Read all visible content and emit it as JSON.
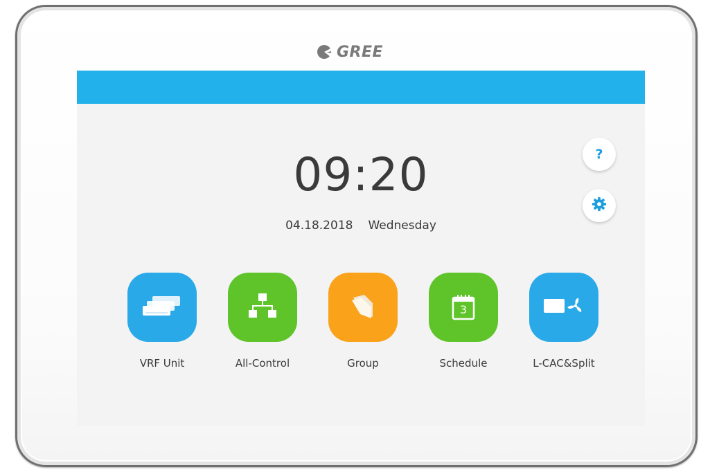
{
  "brand": {
    "name": "GREE",
    "logo_icon": "gree-logo-icon"
  },
  "colors": {
    "header_bar": "#22b1ea",
    "tile_blue": "#2aa9e8",
    "tile_green": "#5fc42a",
    "tile_orange": "#f9a21a",
    "accent_icon": "#1e9ee0"
  },
  "clock": {
    "time": "09:20",
    "date": "04.18.2018",
    "weekday": "Wednesday"
  },
  "side_buttons": [
    {
      "name": "help",
      "glyph": "?",
      "icon": "question-icon"
    },
    {
      "name": "settings",
      "icon": "gear-icon"
    }
  ],
  "tiles": [
    {
      "label": "VRF Unit",
      "icon": "indoor-units-icon",
      "color": "blue"
    },
    {
      "label": "All-Control",
      "icon": "network-hierarchy-icon",
      "color": "green"
    },
    {
      "label": "Group",
      "icon": "folder-icon",
      "color": "orange"
    },
    {
      "label": "Schedule",
      "icon": "calendar-icon",
      "calendar_day": "3",
      "color": "green"
    },
    {
      "label": "L-CAC&Split",
      "icon": "split-ac-fan-icon",
      "color": "blue"
    }
  ]
}
